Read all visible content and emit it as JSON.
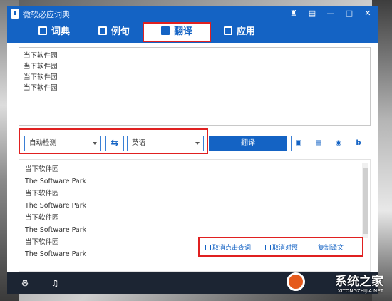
{
  "window": {
    "title": "微软必应词典"
  },
  "tabs": [
    {
      "label": "词典",
      "icon": "book-icon"
    },
    {
      "label": "例句",
      "icon": "sentence-icon"
    },
    {
      "label": "翻译",
      "icon": "translate-icon",
      "active": true
    },
    {
      "label": "应用",
      "icon": "apps-icon"
    }
  ],
  "input": {
    "lines": [
      "当下软件园",
      "当下软件园",
      "当下软件园",
      "当下软件园"
    ]
  },
  "toolbar": {
    "source_lang": "自动检测",
    "target_lang": "英语",
    "swap_icon": "swap-icon",
    "translate_label": "翻译",
    "extra_icons": [
      "delete-icon",
      "window-icon",
      "weibo-icon",
      "bing-icon"
    ]
  },
  "output": {
    "pairs": [
      {
        "source": "当下软件园",
        "target": "The Software Park"
      },
      {
        "source": "当下软件园",
        "target": "The Software Park"
      },
      {
        "source": "当下软件园",
        "target": "The Software Park"
      },
      {
        "source": "当下软件园",
        "target": "The Software Park"
      }
    ]
  },
  "actions": {
    "cancel_click_lookup": "取消点击查词",
    "cancel_contrast": "取消对照",
    "copy_translation": "复制译文"
  },
  "statusbar": {
    "icons": [
      "gear-icon",
      "voice-icon"
    ]
  },
  "watermark": {
    "title": "系统之家",
    "url": "XITONGZHIJIA.NET"
  },
  "colors": {
    "accent": "#1463c4",
    "highlight": "#e02020",
    "statusbar": "#1c2533"
  }
}
